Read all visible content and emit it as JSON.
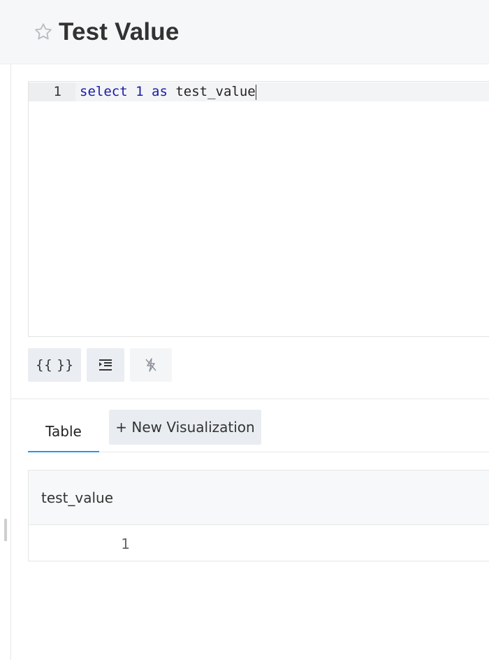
{
  "header": {
    "title": "Test Value",
    "favorite_icon": "star-outline-icon"
  },
  "editor": {
    "line_number": "1",
    "code": {
      "kw_select": "select",
      "num": "1",
      "kw_as": "as",
      "ident": "test_value"
    }
  },
  "toolbar": {
    "params_label": "{{ }}",
    "format_icon": "indent-icon",
    "autocomplete_icon": "flash-off-icon"
  },
  "tabs": {
    "table_label": "Table",
    "new_viz_label": "+ New Visualization"
  },
  "results": {
    "columns": [
      "test_value"
    ],
    "rows": [
      [
        "1"
      ]
    ]
  },
  "colors": {
    "accent": "#2196f3",
    "keyword": "#1a1aa6"
  }
}
